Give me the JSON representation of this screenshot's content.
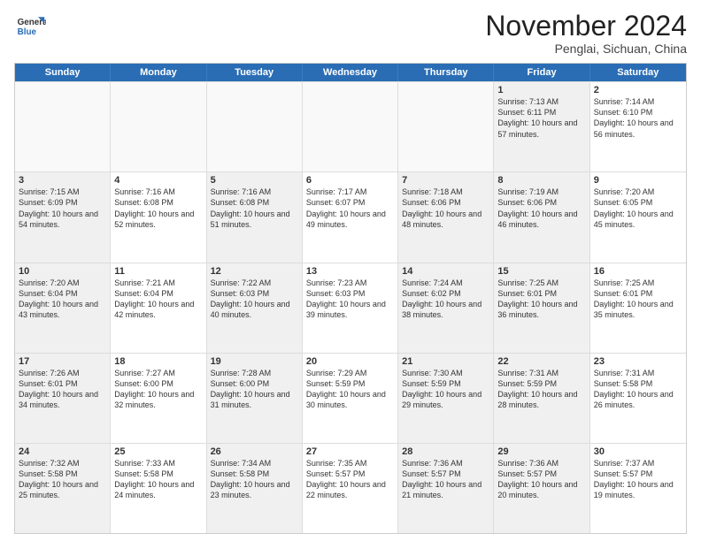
{
  "logo": {
    "general": "General",
    "blue": "Blue"
  },
  "header": {
    "month": "November 2024",
    "location": "Penglai, Sichuan, China"
  },
  "weekdays": [
    "Sunday",
    "Monday",
    "Tuesday",
    "Wednesday",
    "Thursday",
    "Friday",
    "Saturday"
  ],
  "rows": [
    [
      {
        "day": "",
        "text": "",
        "shaded": false,
        "empty": true
      },
      {
        "day": "",
        "text": "",
        "shaded": false,
        "empty": true
      },
      {
        "day": "",
        "text": "",
        "shaded": false,
        "empty": true
      },
      {
        "day": "",
        "text": "",
        "shaded": false,
        "empty": true
      },
      {
        "day": "",
        "text": "",
        "shaded": false,
        "empty": true
      },
      {
        "day": "1",
        "text": "Sunrise: 7:13 AM\nSunset: 6:11 PM\nDaylight: 10 hours and 57 minutes.",
        "shaded": true,
        "empty": false
      },
      {
        "day": "2",
        "text": "Sunrise: 7:14 AM\nSunset: 6:10 PM\nDaylight: 10 hours and 56 minutes.",
        "shaded": false,
        "empty": false
      }
    ],
    [
      {
        "day": "3",
        "text": "Sunrise: 7:15 AM\nSunset: 6:09 PM\nDaylight: 10 hours and 54 minutes.",
        "shaded": true,
        "empty": false
      },
      {
        "day": "4",
        "text": "Sunrise: 7:16 AM\nSunset: 6:08 PM\nDaylight: 10 hours and 52 minutes.",
        "shaded": false,
        "empty": false
      },
      {
        "day": "5",
        "text": "Sunrise: 7:16 AM\nSunset: 6:08 PM\nDaylight: 10 hours and 51 minutes.",
        "shaded": true,
        "empty": false
      },
      {
        "day": "6",
        "text": "Sunrise: 7:17 AM\nSunset: 6:07 PM\nDaylight: 10 hours and 49 minutes.",
        "shaded": false,
        "empty": false
      },
      {
        "day": "7",
        "text": "Sunrise: 7:18 AM\nSunset: 6:06 PM\nDaylight: 10 hours and 48 minutes.",
        "shaded": true,
        "empty": false
      },
      {
        "day": "8",
        "text": "Sunrise: 7:19 AM\nSunset: 6:06 PM\nDaylight: 10 hours and 46 minutes.",
        "shaded": true,
        "empty": false
      },
      {
        "day": "9",
        "text": "Sunrise: 7:20 AM\nSunset: 6:05 PM\nDaylight: 10 hours and 45 minutes.",
        "shaded": false,
        "empty": false
      }
    ],
    [
      {
        "day": "10",
        "text": "Sunrise: 7:20 AM\nSunset: 6:04 PM\nDaylight: 10 hours and 43 minutes.",
        "shaded": true,
        "empty": false
      },
      {
        "day": "11",
        "text": "Sunrise: 7:21 AM\nSunset: 6:04 PM\nDaylight: 10 hours and 42 minutes.",
        "shaded": false,
        "empty": false
      },
      {
        "day": "12",
        "text": "Sunrise: 7:22 AM\nSunset: 6:03 PM\nDaylight: 10 hours and 40 minutes.",
        "shaded": true,
        "empty": false
      },
      {
        "day": "13",
        "text": "Sunrise: 7:23 AM\nSunset: 6:03 PM\nDaylight: 10 hours and 39 minutes.",
        "shaded": false,
        "empty": false
      },
      {
        "day": "14",
        "text": "Sunrise: 7:24 AM\nSunset: 6:02 PM\nDaylight: 10 hours and 38 minutes.",
        "shaded": true,
        "empty": false
      },
      {
        "day": "15",
        "text": "Sunrise: 7:25 AM\nSunset: 6:01 PM\nDaylight: 10 hours and 36 minutes.",
        "shaded": true,
        "empty": false
      },
      {
        "day": "16",
        "text": "Sunrise: 7:25 AM\nSunset: 6:01 PM\nDaylight: 10 hours and 35 minutes.",
        "shaded": false,
        "empty": false
      }
    ],
    [
      {
        "day": "17",
        "text": "Sunrise: 7:26 AM\nSunset: 6:01 PM\nDaylight: 10 hours and 34 minutes.",
        "shaded": true,
        "empty": false
      },
      {
        "day": "18",
        "text": "Sunrise: 7:27 AM\nSunset: 6:00 PM\nDaylight: 10 hours and 32 minutes.",
        "shaded": false,
        "empty": false
      },
      {
        "day": "19",
        "text": "Sunrise: 7:28 AM\nSunset: 6:00 PM\nDaylight: 10 hours and 31 minutes.",
        "shaded": true,
        "empty": false
      },
      {
        "day": "20",
        "text": "Sunrise: 7:29 AM\nSunset: 5:59 PM\nDaylight: 10 hours and 30 minutes.",
        "shaded": false,
        "empty": false
      },
      {
        "day": "21",
        "text": "Sunrise: 7:30 AM\nSunset: 5:59 PM\nDaylight: 10 hours and 29 minutes.",
        "shaded": true,
        "empty": false
      },
      {
        "day": "22",
        "text": "Sunrise: 7:31 AM\nSunset: 5:59 PM\nDaylight: 10 hours and 28 minutes.",
        "shaded": true,
        "empty": false
      },
      {
        "day": "23",
        "text": "Sunrise: 7:31 AM\nSunset: 5:58 PM\nDaylight: 10 hours and 26 minutes.",
        "shaded": false,
        "empty": false
      }
    ],
    [
      {
        "day": "24",
        "text": "Sunrise: 7:32 AM\nSunset: 5:58 PM\nDaylight: 10 hours and 25 minutes.",
        "shaded": true,
        "empty": false
      },
      {
        "day": "25",
        "text": "Sunrise: 7:33 AM\nSunset: 5:58 PM\nDaylight: 10 hours and 24 minutes.",
        "shaded": false,
        "empty": false
      },
      {
        "day": "26",
        "text": "Sunrise: 7:34 AM\nSunset: 5:58 PM\nDaylight: 10 hours and 23 minutes.",
        "shaded": true,
        "empty": false
      },
      {
        "day": "27",
        "text": "Sunrise: 7:35 AM\nSunset: 5:57 PM\nDaylight: 10 hours and 22 minutes.",
        "shaded": false,
        "empty": false
      },
      {
        "day": "28",
        "text": "Sunrise: 7:36 AM\nSunset: 5:57 PM\nDaylight: 10 hours and 21 minutes.",
        "shaded": true,
        "empty": false
      },
      {
        "day": "29",
        "text": "Sunrise: 7:36 AM\nSunset: 5:57 PM\nDaylight: 10 hours and 20 minutes.",
        "shaded": true,
        "empty": false
      },
      {
        "day": "30",
        "text": "Sunrise: 7:37 AM\nSunset: 5:57 PM\nDaylight: 10 hours and 19 minutes.",
        "shaded": false,
        "empty": false
      }
    ]
  ]
}
